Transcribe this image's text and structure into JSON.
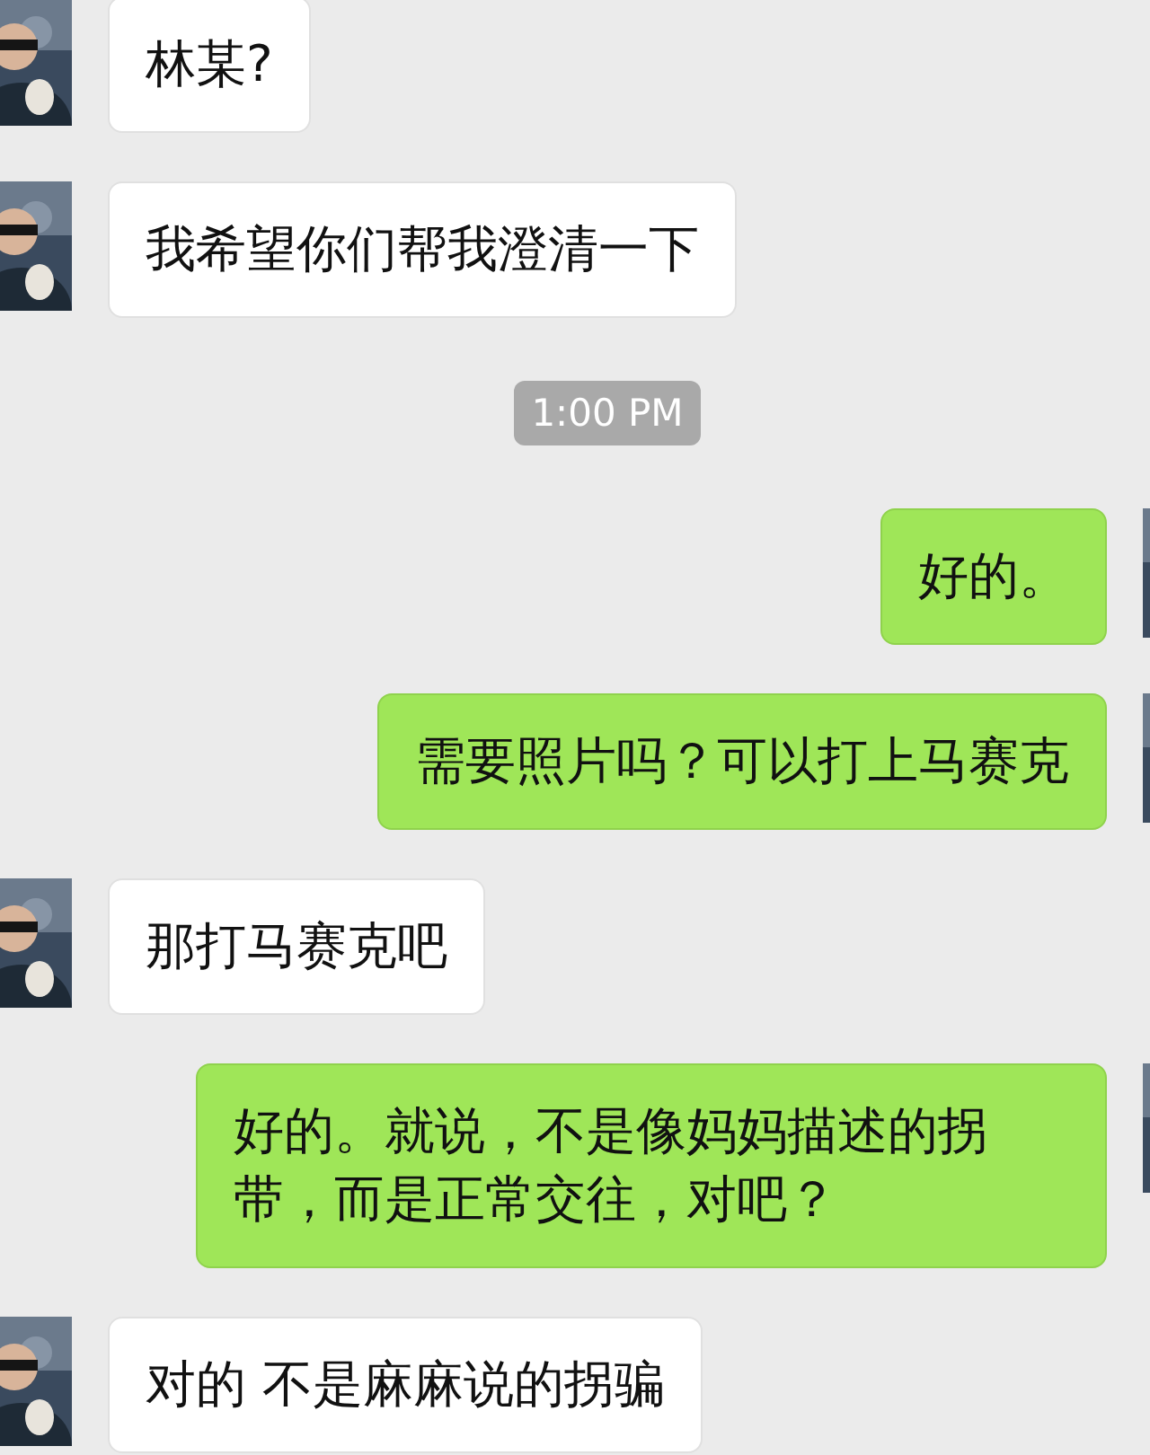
{
  "messages": [
    {
      "kind": "received",
      "text": "林某?"
    },
    {
      "kind": "received",
      "text": "我希望你们帮我澄清一下"
    },
    {
      "kind": "time",
      "text": "1:00 PM"
    },
    {
      "kind": "sent",
      "text": "好的。"
    },
    {
      "kind": "sent",
      "text": "需要照片吗？可以打上马赛克"
    },
    {
      "kind": "received",
      "text": "那打马赛克吧"
    },
    {
      "kind": "sent",
      "text": "好的。就说，不是像妈妈描述的拐带，而是正常交往，对吧？"
    },
    {
      "kind": "received",
      "text": "对的 不是麻麻说的拐骗"
    }
  ]
}
